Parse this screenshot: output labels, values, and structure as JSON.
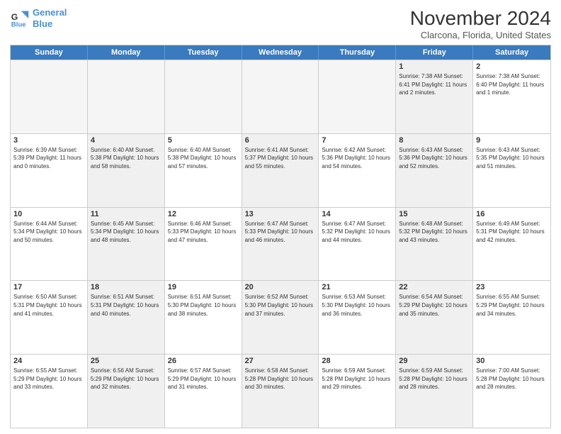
{
  "logo": {
    "line1": "General",
    "line2": "Blue"
  },
  "title": "November 2024",
  "location": "Clarcona, Florida, United States",
  "days_of_week": [
    "Sunday",
    "Monday",
    "Tuesday",
    "Wednesday",
    "Thursday",
    "Friday",
    "Saturday"
  ],
  "weeks": [
    [
      {
        "day": "",
        "empty": true,
        "text": ""
      },
      {
        "day": "",
        "empty": true,
        "text": ""
      },
      {
        "day": "",
        "empty": true,
        "text": ""
      },
      {
        "day": "",
        "empty": true,
        "text": ""
      },
      {
        "day": "",
        "empty": true,
        "text": ""
      },
      {
        "day": "1",
        "empty": false,
        "shaded": true,
        "text": "Sunrise: 7:38 AM\nSunset: 6:41 PM\nDaylight: 11 hours\nand 2 minutes."
      },
      {
        "day": "2",
        "empty": false,
        "shaded": false,
        "text": "Sunrise: 7:38 AM\nSunset: 6:40 PM\nDaylight: 11 hours\nand 1 minute."
      }
    ],
    [
      {
        "day": "3",
        "empty": false,
        "shaded": false,
        "text": "Sunrise: 6:39 AM\nSunset: 5:39 PM\nDaylight: 11 hours\nand 0 minutes."
      },
      {
        "day": "4",
        "empty": false,
        "shaded": true,
        "text": "Sunrise: 6:40 AM\nSunset: 5:38 PM\nDaylight: 10 hours\nand 58 minutes."
      },
      {
        "day": "5",
        "empty": false,
        "shaded": false,
        "text": "Sunrise: 6:40 AM\nSunset: 5:38 PM\nDaylight: 10 hours\nand 57 minutes."
      },
      {
        "day": "6",
        "empty": false,
        "shaded": true,
        "text": "Sunrise: 6:41 AM\nSunset: 5:37 PM\nDaylight: 10 hours\nand 55 minutes."
      },
      {
        "day": "7",
        "empty": false,
        "shaded": false,
        "text": "Sunrise: 6:42 AM\nSunset: 5:36 PM\nDaylight: 10 hours\nand 54 minutes."
      },
      {
        "day": "8",
        "empty": false,
        "shaded": true,
        "text": "Sunrise: 6:43 AM\nSunset: 5:36 PM\nDaylight: 10 hours\nand 52 minutes."
      },
      {
        "day": "9",
        "empty": false,
        "shaded": false,
        "text": "Sunrise: 6:43 AM\nSunset: 5:35 PM\nDaylight: 10 hours\nand 51 minutes."
      }
    ],
    [
      {
        "day": "10",
        "empty": false,
        "shaded": false,
        "text": "Sunrise: 6:44 AM\nSunset: 5:34 PM\nDaylight: 10 hours\nand 50 minutes."
      },
      {
        "day": "11",
        "empty": false,
        "shaded": true,
        "text": "Sunrise: 6:45 AM\nSunset: 5:34 PM\nDaylight: 10 hours\nand 48 minutes."
      },
      {
        "day": "12",
        "empty": false,
        "shaded": false,
        "text": "Sunrise: 6:46 AM\nSunset: 5:33 PM\nDaylight: 10 hours\nand 47 minutes."
      },
      {
        "day": "13",
        "empty": false,
        "shaded": true,
        "text": "Sunrise: 6:47 AM\nSunset: 5:33 PM\nDaylight: 10 hours\nand 46 minutes."
      },
      {
        "day": "14",
        "empty": false,
        "shaded": false,
        "text": "Sunrise: 6:47 AM\nSunset: 5:32 PM\nDaylight: 10 hours\nand 44 minutes."
      },
      {
        "day": "15",
        "empty": false,
        "shaded": true,
        "text": "Sunrise: 6:48 AM\nSunset: 5:32 PM\nDaylight: 10 hours\nand 43 minutes."
      },
      {
        "day": "16",
        "empty": false,
        "shaded": false,
        "text": "Sunrise: 6:49 AM\nSunset: 5:31 PM\nDaylight: 10 hours\nand 42 minutes."
      }
    ],
    [
      {
        "day": "17",
        "empty": false,
        "shaded": false,
        "text": "Sunrise: 6:50 AM\nSunset: 5:31 PM\nDaylight: 10 hours\nand 41 minutes."
      },
      {
        "day": "18",
        "empty": false,
        "shaded": true,
        "text": "Sunrise: 6:51 AM\nSunset: 5:31 PM\nDaylight: 10 hours\nand 40 minutes."
      },
      {
        "day": "19",
        "empty": false,
        "shaded": false,
        "text": "Sunrise: 6:51 AM\nSunset: 5:30 PM\nDaylight: 10 hours\nand 38 minutes."
      },
      {
        "day": "20",
        "empty": false,
        "shaded": true,
        "text": "Sunrise: 6:52 AM\nSunset: 5:30 PM\nDaylight: 10 hours\nand 37 minutes."
      },
      {
        "day": "21",
        "empty": false,
        "shaded": false,
        "text": "Sunrise: 6:53 AM\nSunset: 5:30 PM\nDaylight: 10 hours\nand 36 minutes."
      },
      {
        "day": "22",
        "empty": false,
        "shaded": true,
        "text": "Sunrise: 6:54 AM\nSunset: 5:29 PM\nDaylight: 10 hours\nand 35 minutes."
      },
      {
        "day": "23",
        "empty": false,
        "shaded": false,
        "text": "Sunrise: 6:55 AM\nSunset: 5:29 PM\nDaylight: 10 hours\nand 34 minutes."
      }
    ],
    [
      {
        "day": "24",
        "empty": false,
        "shaded": false,
        "text": "Sunrise: 6:55 AM\nSunset: 5:29 PM\nDaylight: 10 hours\nand 33 minutes."
      },
      {
        "day": "25",
        "empty": false,
        "shaded": true,
        "text": "Sunrise: 6:56 AM\nSunset: 5:29 PM\nDaylight: 10 hours\nand 32 minutes."
      },
      {
        "day": "26",
        "empty": false,
        "shaded": false,
        "text": "Sunrise: 6:57 AM\nSunset: 5:29 PM\nDaylight: 10 hours\nand 31 minutes."
      },
      {
        "day": "27",
        "empty": false,
        "shaded": true,
        "text": "Sunrise: 6:58 AM\nSunset: 5:28 PM\nDaylight: 10 hours\nand 30 minutes."
      },
      {
        "day": "28",
        "empty": false,
        "shaded": false,
        "text": "Sunrise: 6:59 AM\nSunset: 5:28 PM\nDaylight: 10 hours\nand 29 minutes."
      },
      {
        "day": "29",
        "empty": false,
        "shaded": true,
        "text": "Sunrise: 6:59 AM\nSunset: 5:28 PM\nDaylight: 10 hours\nand 28 minutes."
      },
      {
        "day": "30",
        "empty": false,
        "shaded": false,
        "text": "Sunrise: 7:00 AM\nSunset: 5:28 PM\nDaylight: 10 hours\nand 28 minutes."
      }
    ]
  ]
}
